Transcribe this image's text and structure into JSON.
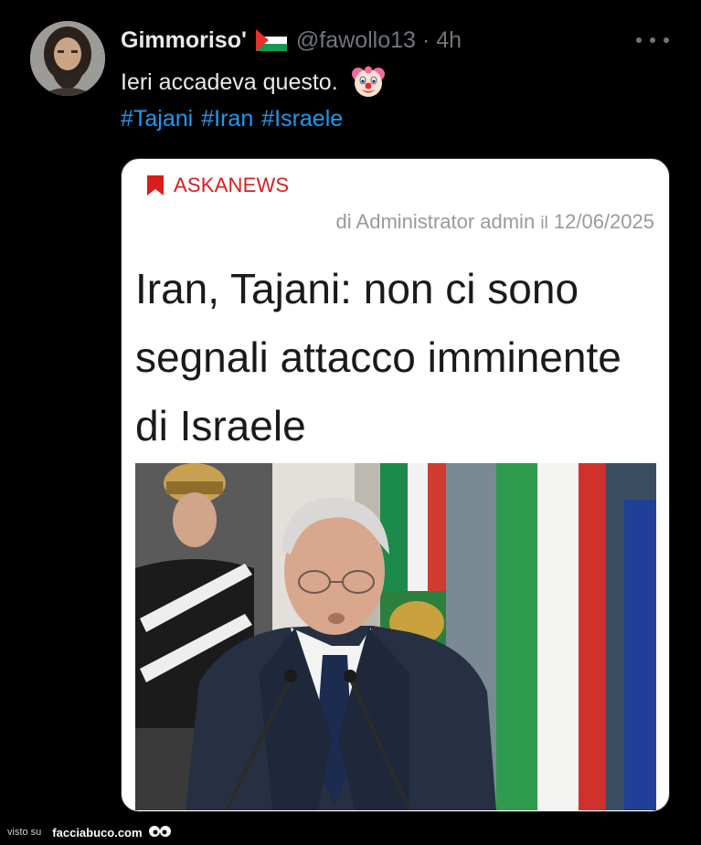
{
  "tweet": {
    "display_name": "Gimmoriso'",
    "flag_icon": "palestine-flag-icon",
    "handle": "@fawollo13",
    "separator": "·",
    "time": "4h",
    "more_icon": "more-horizontal-icon",
    "text": "Ieri accadeva questo.",
    "emoji_icon": "clown-face-icon",
    "hashtags": [
      "#Tajani",
      "#Iran",
      "#Israele"
    ]
  },
  "card": {
    "source_icon": "bookmark-icon",
    "source": "ASKANEWS",
    "byline_main": "di Administrator admin",
    "byline_il": "il",
    "byline_date": "12/06/2025",
    "headline": "Iran, Tajani: non ci sono segnali attacco imminente di Israele"
  },
  "watermark": {
    "prefix": "visto su",
    "brand": "facciabuco.com"
  },
  "colors": {
    "background": "#000000",
    "text_primary": "#e7e9ea",
    "text_secondary": "#71767b",
    "link": "#1d9bf0",
    "source_red": "#d81e1e"
  }
}
